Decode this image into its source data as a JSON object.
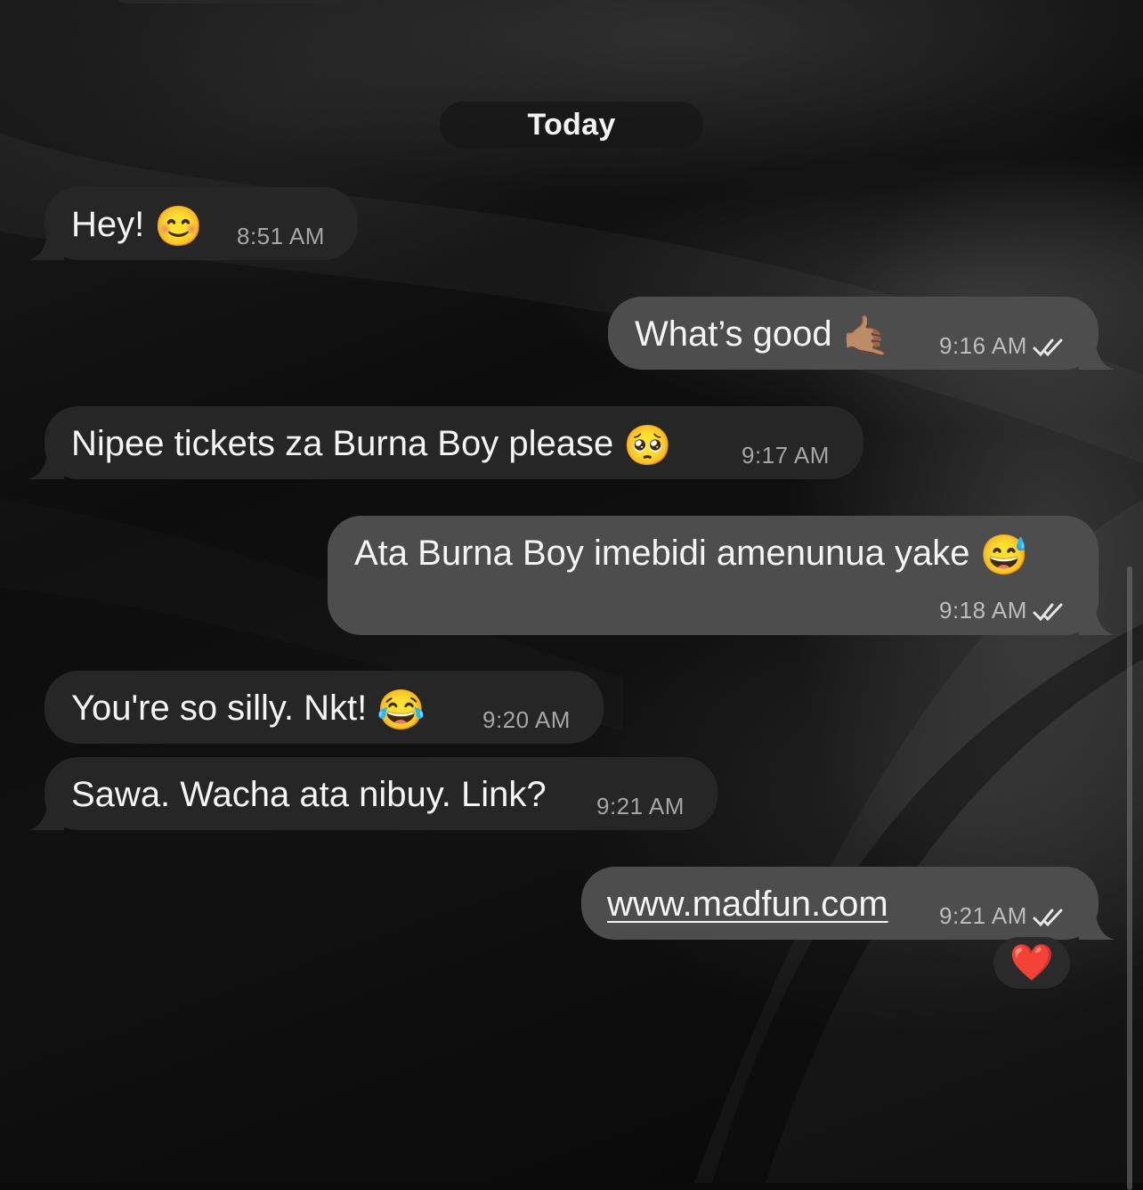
{
  "date_separator": "Today",
  "messages": [
    {
      "direction": "incoming",
      "text": "Hey!",
      "emoji": "😊",
      "time": "8:51 AM"
    },
    {
      "direction": "outgoing",
      "text": "What’s good",
      "emoji": "🤙🏽",
      "time": "9:16 AM",
      "status": "read"
    },
    {
      "direction": "incoming",
      "text": "Nipee tickets za Burna Boy please",
      "emoji": "🥺",
      "time": "9:17 AM"
    },
    {
      "direction": "outgoing",
      "text": "Ata Burna Boy imebidi amenunua yake",
      "emoji": "😅",
      "time": "9:18 AM",
      "status": "read"
    },
    {
      "direction": "incoming",
      "text": "You're so silly. Nkt!",
      "emoji": "😂",
      "time": "9:20 AM"
    },
    {
      "direction": "incoming",
      "text": "Sawa. Wacha ata nibuy. Link?",
      "time": "9:21 AM"
    },
    {
      "direction": "outgoing",
      "text": "www.madfun.com",
      "time": "9:21 AM",
      "status": "read",
      "is_link": true,
      "reaction": "❤️"
    }
  ],
  "colors": {
    "incoming_bubble": "#262626",
    "outgoing_bubble": "#4d4d4d",
    "text": "#f4f4f4",
    "timestamp": "#a6a6a6"
  },
  "icons": {
    "read_status": "double-check-icon"
  }
}
